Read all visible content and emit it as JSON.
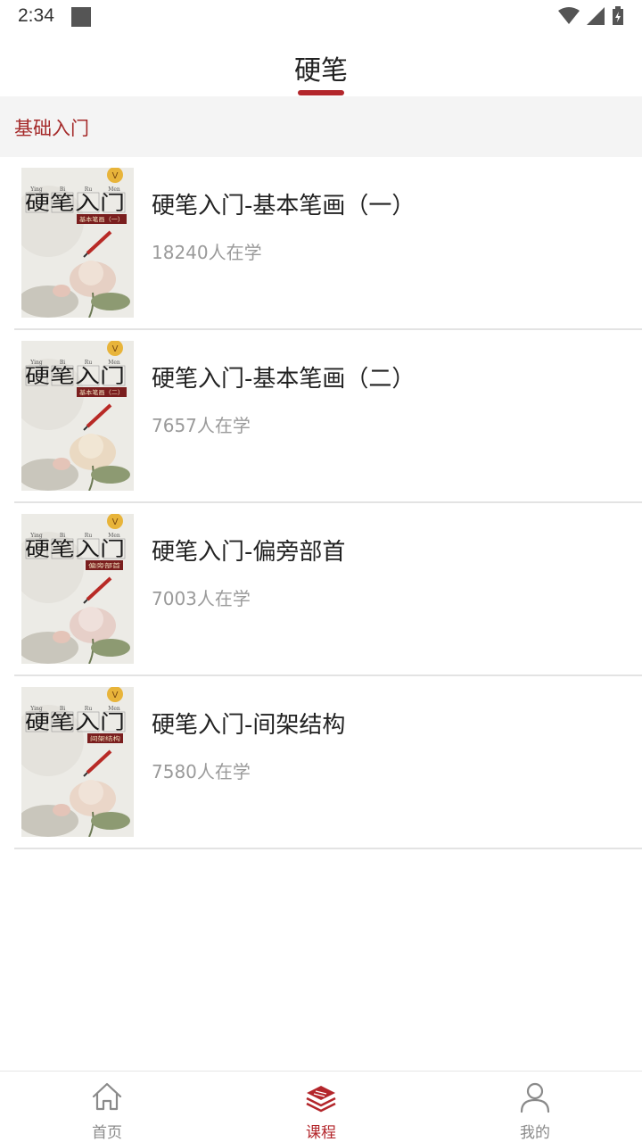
{
  "status_bar": {
    "time": "2:34"
  },
  "header": {
    "title": "硬笔",
    "accent_color": "#b3262b"
  },
  "section": {
    "label": "基础入门"
  },
  "courses": [
    {
      "title": "硬笔入门-基本笔画（一）",
      "learners": "18240人在学",
      "cover": {
        "pinyin": [
          "Ying",
          "Bi",
          "Ru",
          "Men"
        ],
        "title": "硬笔入门",
        "subtitle": "基本笔画（一）",
        "badge": "V"
      }
    },
    {
      "title": "硬笔入门-基本笔画（二）",
      "learners": "7657人在学",
      "cover": {
        "pinyin": [
          "Ying",
          "Bi",
          "Ru",
          "Men"
        ],
        "title": "硬笔入门",
        "subtitle": "基本笔画（二）",
        "badge": "V"
      }
    },
    {
      "title": "硬笔入门-偏旁部首",
      "learners": "7003人在学",
      "cover": {
        "pinyin": [
          "Ying",
          "Bi",
          "Ru",
          "Men"
        ],
        "title": "硬笔入门",
        "subtitle": "偏旁部首",
        "badge": "V"
      }
    },
    {
      "title": "硬笔入门-间架结构",
      "learners": "7580人在学",
      "cover": {
        "pinyin": [
          "Ying",
          "Bi",
          "Ru",
          "Men"
        ],
        "title": "硬笔入门",
        "subtitle": "间架结构",
        "badge": "V"
      }
    }
  ],
  "bottom_nav": [
    {
      "label": "首页",
      "icon": "home-icon",
      "active": false
    },
    {
      "label": "课程",
      "icon": "books-stack-icon",
      "active": true
    },
    {
      "label": "我的",
      "icon": "person-icon",
      "active": false
    }
  ],
  "colors": {
    "accent": "#b3262b",
    "muted_text": "#9a9a9a",
    "section_bg": "#f4f4f4"
  }
}
